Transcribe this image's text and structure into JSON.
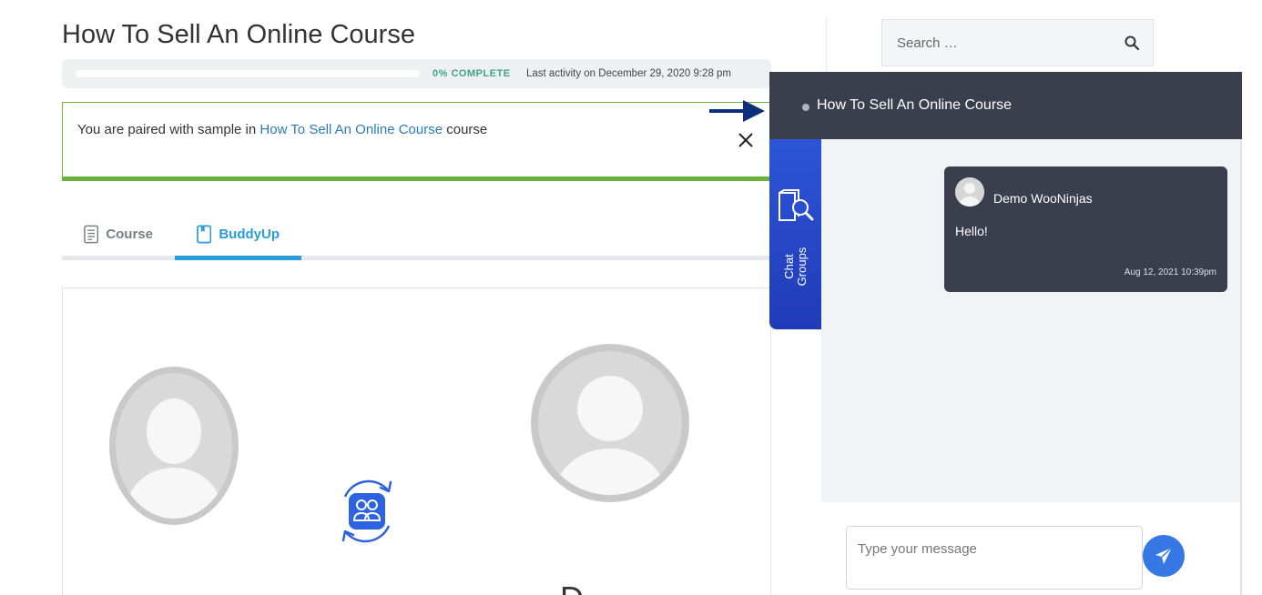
{
  "course": {
    "title": "How To Sell An Online Course",
    "progress_percent": 0,
    "progress_label": "0% COMPLETE",
    "last_activity": "Last activity on December 29, 2020 9:28 pm"
  },
  "notice": {
    "prefix": "You are paired with sample in ",
    "link_text": "How To Sell An Online Course",
    "suffix": " course",
    "close_icon": "close-icon"
  },
  "tabs": [
    {
      "label": "Course",
      "icon": "document-icon",
      "active": false
    },
    {
      "label": "BuddyUp",
      "icon": "bookmark-icon",
      "active": true
    }
  ],
  "buddy_card": {
    "partial_text": "D"
  },
  "search": {
    "placeholder": "Search …",
    "icon": "search-icon"
  },
  "chat": {
    "header_title": "How To Sell An Online Course",
    "tab_label_line1": "Chat",
    "tab_label_line2": "Groups",
    "messages": [
      {
        "author": "Demo WooNinjas",
        "text": "Hello!",
        "time": "Aug 12, 2021 10:39pm"
      }
    ],
    "input_placeholder": "Type your message",
    "send_icon": "send-icon"
  },
  "colors": {
    "accent_blue": "#2a9bdc",
    "progress_green": "#40a586",
    "notice_green": "#6cb13b",
    "chat_dark": "#3b3f4d",
    "chat_tab_blue": "#2d55d8",
    "send_blue": "#3578e5",
    "arrow_navy": "#0d2f7a"
  }
}
